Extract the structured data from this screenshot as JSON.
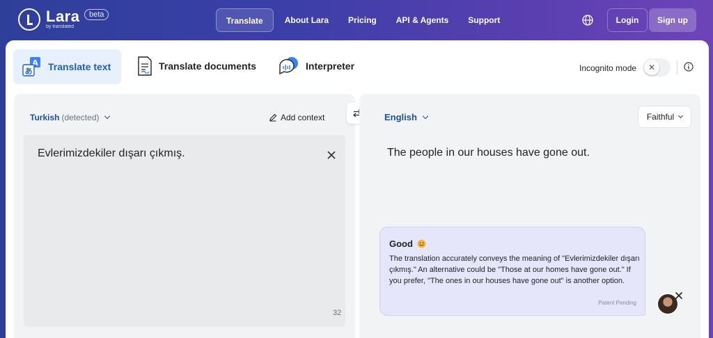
{
  "header": {
    "logo_name": "Lara",
    "logo_sub": "by translated",
    "badge": "beta",
    "nav": [
      {
        "label": "Translate"
      },
      {
        "label": "About Lara"
      },
      {
        "label": "Pricing"
      },
      {
        "label": "API & Agents"
      },
      {
        "label": "Support"
      }
    ],
    "login": "Login",
    "signup": "Sign up"
  },
  "modes": {
    "text": "Translate text",
    "documents": "Translate documents",
    "interpreter": "Interpreter"
  },
  "incognito": {
    "label": "Incognito mode",
    "enabled": false
  },
  "source": {
    "language": "Turkish",
    "detected": "(detected)",
    "add_context": "Add context",
    "text": "Evlerimizdekiler dışarı çıkmış.",
    "char_count": "32"
  },
  "target": {
    "language": "English",
    "style": "Faithful",
    "text": "The people in our houses have gone out."
  },
  "quality": {
    "title": "Good",
    "body": "The translation accurately conveys the meaning of \"Evlerimizdekiler dışarı çıkmış.\" An alternative could be \"Those at our homes have gone out.\" If you prefer, \"The ones in our houses have gone out\" is another option.",
    "footer": "Patent Pending"
  },
  "colors": {
    "accent": "#1d5fbf",
    "bubble": "#e6e6fb"
  }
}
